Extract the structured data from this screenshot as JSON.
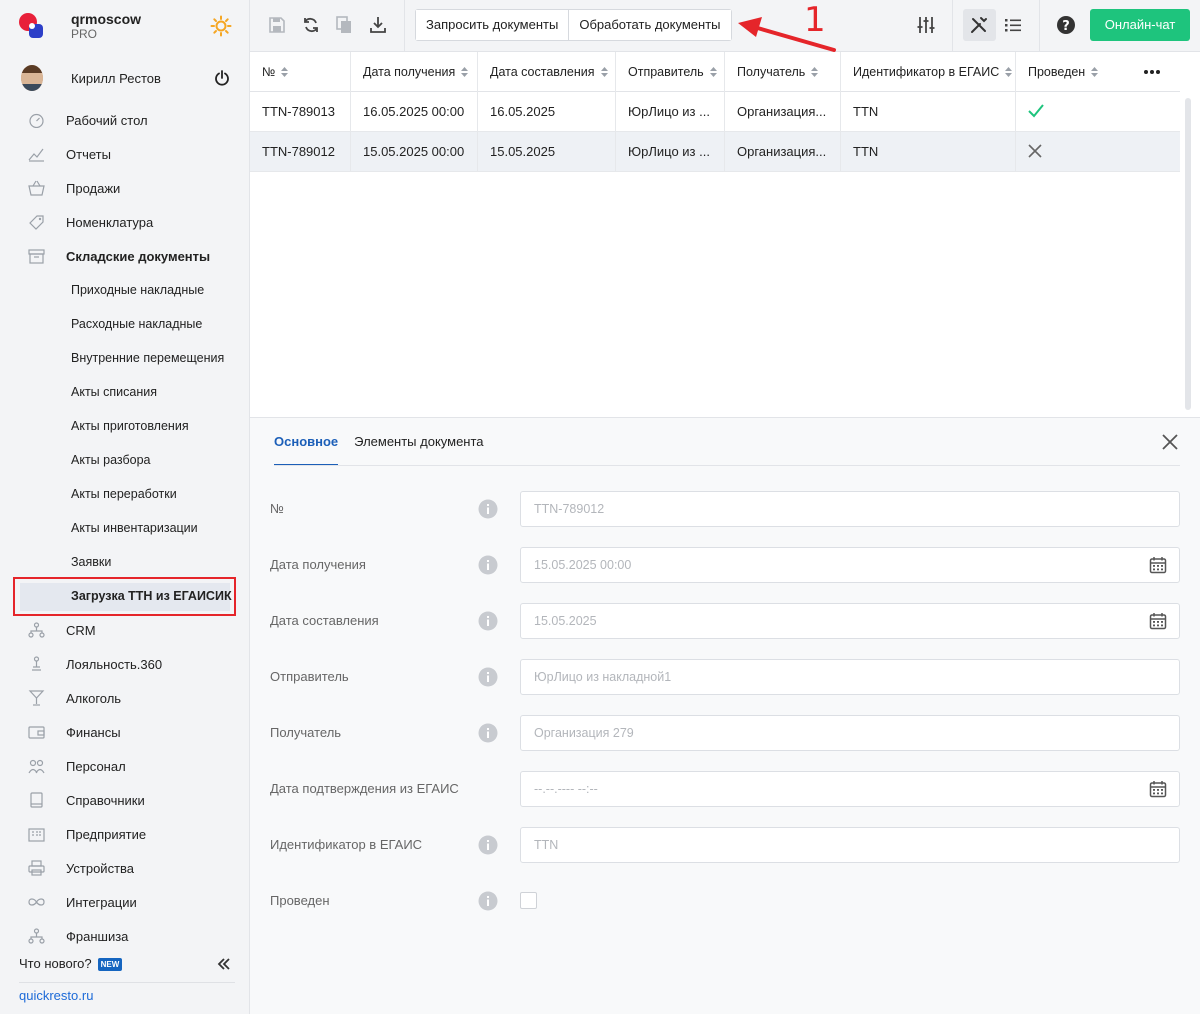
{
  "brand": {
    "name": "qrmoscow",
    "plan": "PRO"
  },
  "user": {
    "name": "Кирилл Рестов"
  },
  "nav": {
    "items_top": [
      {
        "label": "Рабочий стол",
        "icon": "dashboard-icon"
      },
      {
        "label": "Отчеты",
        "icon": "chart-icon"
      },
      {
        "label": "Продажи",
        "icon": "basket-icon"
      },
      {
        "label": "Номенклатура",
        "icon": "tag-icon"
      },
      {
        "label": "Складские документы",
        "icon": "warehouse-icon"
      }
    ],
    "sub_items": [
      "Приходные накладные",
      "Расходные накладные",
      "Внутренние перемещения",
      "Акты списания",
      "Акты приготовления",
      "Акты разбора",
      "Акты переработки",
      "Акты инвентаризации",
      "Заявки",
      "Загрузка ТТН из ЕГАИСИК"
    ],
    "items_bottom": [
      {
        "label": "CRM",
        "icon": "crm-icon"
      },
      {
        "label": "Лояльность.360",
        "icon": "loyalty-icon"
      },
      {
        "label": "Алкоголь",
        "icon": "glass-icon"
      },
      {
        "label": "Финансы",
        "icon": "wallet-icon"
      },
      {
        "label": "Персонал",
        "icon": "people-icon"
      },
      {
        "label": "Справочники",
        "icon": "book-icon"
      },
      {
        "label": "Предприятие",
        "icon": "building-icon"
      },
      {
        "label": "Устройства",
        "icon": "printer-icon"
      },
      {
        "label": "Интеграции",
        "icon": "infinity-icon"
      },
      {
        "label": "Франшиза",
        "icon": "franchise-icon"
      }
    ],
    "whats_new": "Что нового?",
    "new_badge": "NEW",
    "site": "quickresto.ru"
  },
  "toolbar": {
    "request_docs": "Запросить документы",
    "process_docs": "Обработать документы",
    "chat": "Онлайн-чат",
    "annotation_number": "1"
  },
  "table": {
    "columns": [
      "№",
      "Дата получения",
      "Дата составления",
      "Отправитель",
      "Получатель",
      "Идентификатор в ЕГАИС",
      "Проведен"
    ],
    "rows": [
      {
        "num": "TTN-789013",
        "received": "16.05.2025 00:00",
        "composed": "16.05.2025",
        "sender": "ЮрЛицо из ...",
        "recipient": "Организация...",
        "egais_id": "TTN",
        "posted": true
      },
      {
        "num": "TTN-789012",
        "received": "15.05.2025 00:00",
        "composed": "15.05.2025",
        "sender": "ЮрЛицо из ...",
        "recipient": "Организация...",
        "egais_id": "TTN",
        "posted": false
      }
    ]
  },
  "detail": {
    "tabs": [
      "Основное",
      "Элементы документа"
    ],
    "fields": [
      {
        "label": "№",
        "value": "TTN-789012"
      },
      {
        "label": "Дата получения",
        "value": "15.05.2025 00:00"
      },
      {
        "label": "Дата составления",
        "value": "15.05.2025"
      },
      {
        "label": "Отправитель",
        "value": "ЮрЛицо из накладной1"
      },
      {
        "label": "Получатель",
        "value": "Организация 279"
      },
      {
        "label": "Дата подтверждения из ЕГАИС",
        "value": "--.--.---- --:--"
      },
      {
        "label": "Идентификатор в ЕГАИС",
        "value": "TTN"
      },
      {
        "label": "Проведен",
        "value": ""
      }
    ]
  },
  "colors": {
    "accent": "#1c5fb8",
    "chat": "#1ec47d",
    "annotation": "#e5252a",
    "check": "#1ec47d"
  }
}
